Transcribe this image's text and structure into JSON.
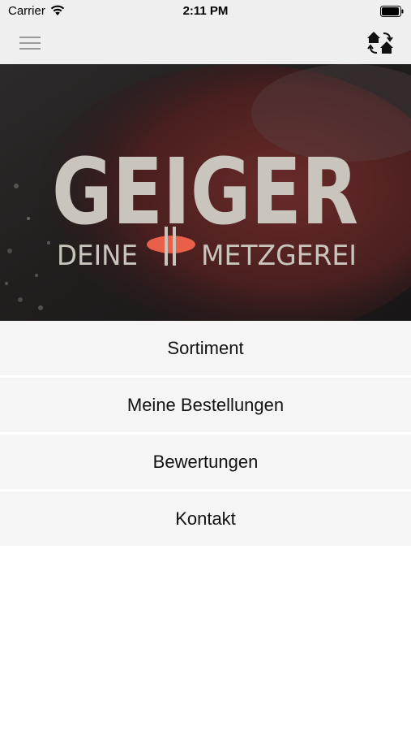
{
  "status": {
    "carrier": "Carrier",
    "time": "2:11 PM",
    "battery_level": 0.9
  },
  "nav": {
    "menu_icon": "hamburger-icon",
    "switch_icon": "switch-store-icon"
  },
  "hero": {
    "brand_name": "GEIGER",
    "tagline_left": "DEINE",
    "tagline_right": "METZGEREI",
    "text_color": "#c9c5bd",
    "sausage_color": "#e8604a"
  },
  "menu": {
    "items": [
      {
        "label": "Sortiment"
      },
      {
        "label": "Meine Bestellungen"
      },
      {
        "label": "Bewertungen"
      },
      {
        "label": "Kontakt"
      }
    ]
  }
}
